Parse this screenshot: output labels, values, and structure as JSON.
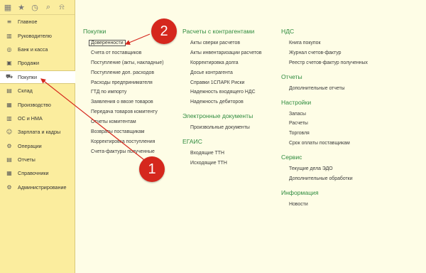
{
  "toolbar": {
    "icons": [
      "grid-icon",
      "star-icon",
      "history-icon",
      "search-icon",
      "bell-icon"
    ]
  },
  "sidebar": {
    "items": [
      {
        "label": "Главное",
        "icon": "menu-icon"
      },
      {
        "label": "Руководителю",
        "icon": "chart-icon"
      },
      {
        "label": "Банк и касса",
        "icon": "coins-icon"
      },
      {
        "label": "Продажи",
        "icon": "bag-icon"
      },
      {
        "label": "Покупки",
        "icon": "cart-icon",
        "active": true
      },
      {
        "label": "Склад",
        "icon": "warehouse-icon"
      },
      {
        "label": "Производство",
        "icon": "factory-icon"
      },
      {
        "label": "ОС и НМА",
        "icon": "building-icon"
      },
      {
        "label": "Зарплата и кадры",
        "icon": "people-icon"
      },
      {
        "label": "Операции",
        "icon": "operations-icon"
      },
      {
        "label": "Отчеты",
        "icon": "report-icon"
      },
      {
        "label": "Справочники",
        "icon": "book-icon"
      },
      {
        "label": "Администрирование",
        "icon": "gear-icon"
      }
    ]
  },
  "sections": {
    "purchases": {
      "title": "Покупки",
      "links": [
        "Доверенности",
        "Счета от поставщиков",
        "Поступление (акты, накладные)",
        "Поступление доп. расходов",
        "Расходы предпринимателя",
        "ГТД по импорту",
        "Заявления о ввозе товаров",
        "Передача товаров комитенту",
        "Отчеты комитентам",
        "Возвраты поставщикам",
        "Корректировка поступления",
        "Счета-фактуры полученные"
      ]
    },
    "settlements": {
      "title": "Расчеты с контрагентами",
      "links": [
        "Акты сверки расчетов",
        "Акты инвентаризации расчетов",
        "Корректировка долга",
        "Досье контрагента",
        "Справки 1СПАРК Риски",
        "Надежность входящего НДС",
        "Надежность дебиторов"
      ]
    },
    "edocs": {
      "title": "Электронные документы",
      "links": [
        "Произвольные документы"
      ]
    },
    "egais": {
      "title": "ЕГАИС",
      "links": [
        "Входящие ТТН",
        "Исходящие ТТН"
      ]
    },
    "vat": {
      "title": "НДС",
      "links": [
        "Книга покупок",
        "Журнал счетов-фактур",
        "Реестр счетов-фактур полученных"
      ]
    },
    "reports": {
      "title": "Отчеты",
      "links": [
        "Дополнительные отчеты"
      ]
    },
    "settings": {
      "title": "Настройки",
      "links": [
        "Запасы",
        "Расчеты",
        "Торговля",
        "Срок оплаты поставщикам"
      ]
    },
    "service": {
      "title": "Сервис",
      "links": [
        "Текущие дела ЭДО",
        "Дополнительные обработки"
      ]
    },
    "info": {
      "title": "Информация",
      "links": [
        "Новости"
      ]
    }
  },
  "annotations": {
    "badge1": "1",
    "badge2": "2",
    "color": "#d5271d"
  }
}
